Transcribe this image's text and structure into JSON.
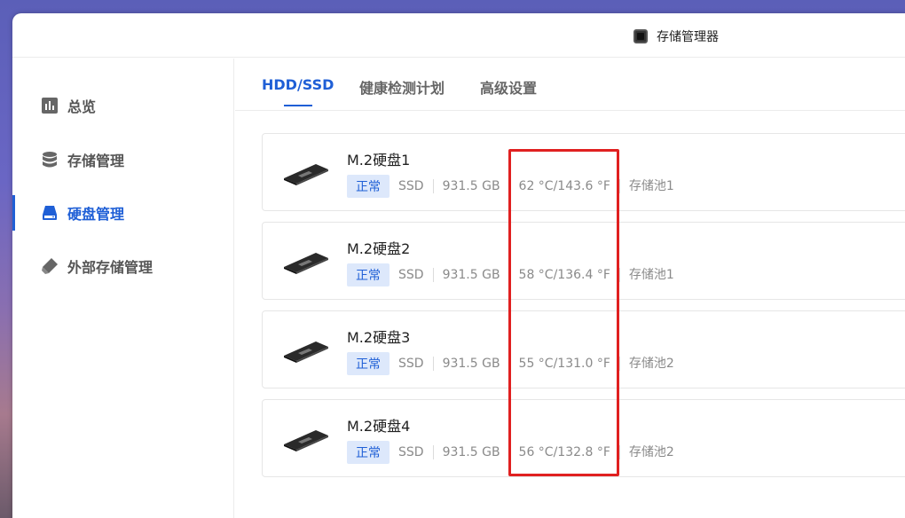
{
  "app": {
    "title": "存储管理器"
  },
  "sidebar": {
    "items": [
      {
        "label": "总览",
        "icon": "chart-icon"
      },
      {
        "label": "存储管理",
        "icon": "database-icon"
      },
      {
        "label": "硬盘管理",
        "icon": "disk-icon",
        "active": true
      },
      {
        "label": "外部存储管理",
        "icon": "usb-drive-icon"
      }
    ]
  },
  "tabs": [
    {
      "label": "HDD/SSD",
      "active": true
    },
    {
      "label": "健康检测计划"
    },
    {
      "label": "高级设置"
    }
  ],
  "disks": [
    {
      "name": "M.2硬盘1",
      "status": "正常",
      "type": "SSD",
      "size": "931.5 GB",
      "temp": "62 °C/143.6 °F",
      "pool": "存储池1"
    },
    {
      "name": "M.2硬盘2",
      "status": "正常",
      "type": "SSD",
      "size": "931.5 GB",
      "temp": "58 °C/136.4 °F",
      "pool": "存储池1"
    },
    {
      "name": "M.2硬盘3",
      "status": "正常",
      "type": "SSD",
      "size": "931.5 GB",
      "temp": "55 °C/131.0 °F",
      "pool": "存储池2"
    },
    {
      "name": "M.2硬盘4",
      "status": "正常",
      "type": "SSD",
      "size": "931.5 GB",
      "temp": "56 °C/132.8 °F",
      "pool": "存储池2"
    }
  ],
  "colors": {
    "accent": "#1f5fd6",
    "highlight": "#e02020"
  }
}
